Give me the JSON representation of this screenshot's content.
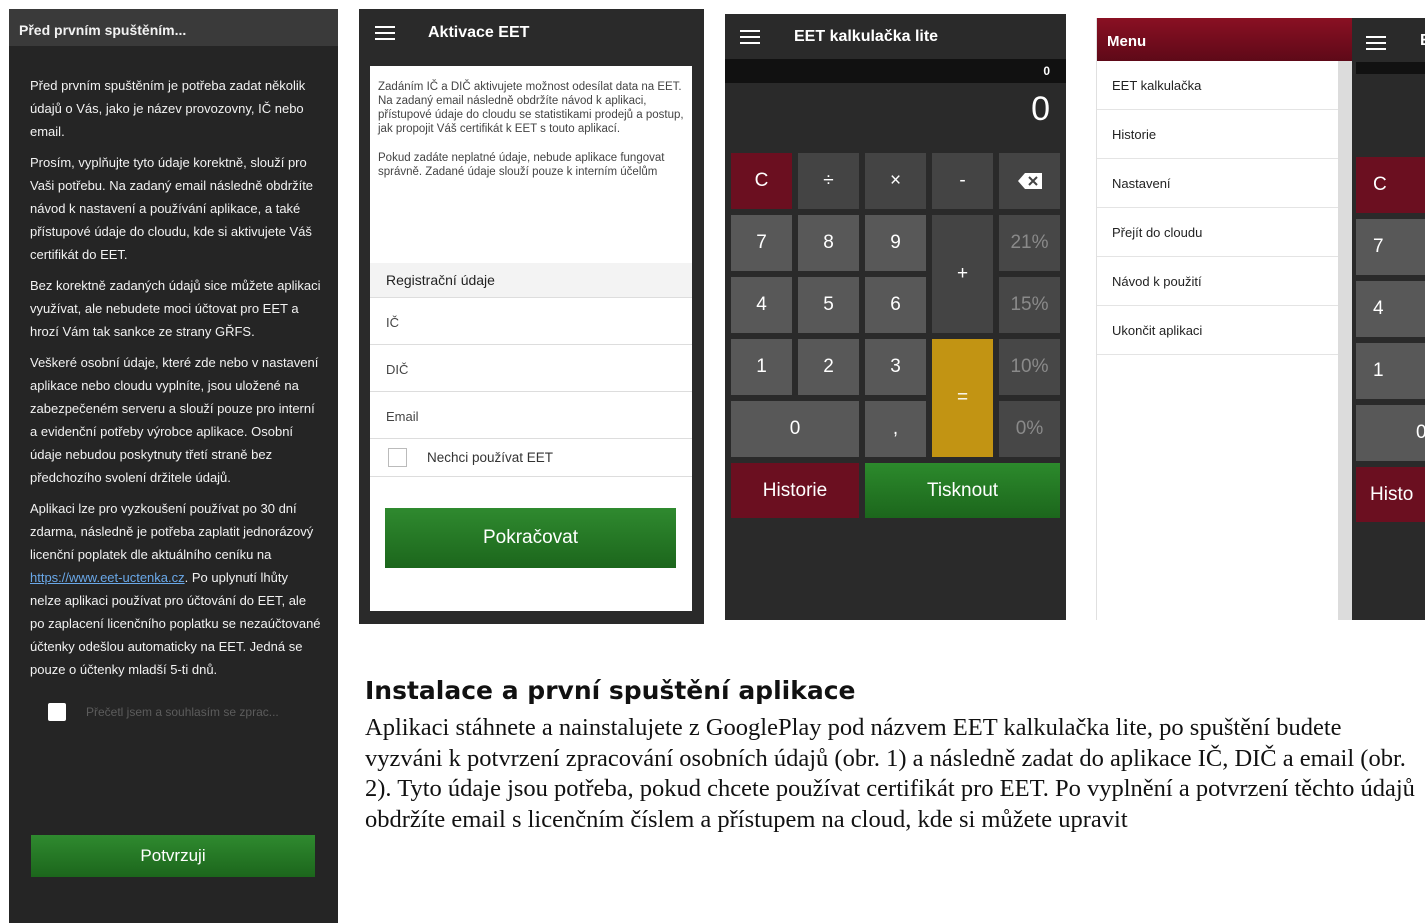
{
  "consent": {
    "title": "Před prvním spuštěním...",
    "para1": "Před prvním spuštěním je potřeba zadat několik údajů o Vás, jako je název provozovny, IČ nebo email.",
    "para2": "Prosím, vyplňujte tyto údaje korektně, slouží pro Vaši potřebu. Na zadaný email následně obdržíte návod k nastavení a používání aplikace, a také přístupové údaje do cloudu, kde si aktivujete Váš certifikát do EET.",
    "para3": "Bez korektně zadaných údajů sice můžete aplikaci využívat, ale nebudete moci účtovat pro EET a hrozí Vám tak sankce ze strany GŘFS.",
    "para4": "Veškeré osobní údaje, které zde nebo v nastavení aplikace nebo cloudu vyplníte, jsou uložené na zabezpečeném serveru a slouží pouze pro interní a evidenční potřeby výrobce aplikace. Osobní údaje nebudou poskytnuty třetí straně bez předchozího svolení držitele údajů.",
    "para5_before": "Aplikaci lze pro vyzkoušení používat po 30 dní zdarma, následně je potřeba zaplatit jednorázový licenční poplatek dle aktuálního ceníku na ",
    "para5_link": "https://www.eet-uctenka.cz",
    "para5_after": ". Po uplynutí lhůty nelze aplikaci používat pro účtování do EET, ale po zaplacení licenčního poplatku se nezaúčtované účtenky odešlou automaticky na EET. Jedná se pouze o účtenky mladší 5-ti dnů.",
    "agree_label": "Přečetl jsem a souhlasím se zprac...",
    "confirm_button": "Potvrzuji"
  },
  "activation": {
    "title": "Aktivace EET",
    "intro1": "Zadáním IČ a DIČ aktivujete možnost odesílat data na EET. Na zadaný email následně obdržíte návod k aplikaci, přístupové údaje do cloudu se statistikami prodejů a postup, jak propojit Váš certifikát k EET s touto aplikací.",
    "intro2": "Pokud zadáte neplatné údaje, nebude aplikace fungovat správně. Zadané údaje slouží pouze k interním účelům",
    "section_title": "Registrační údaje",
    "field_ic": "IČ",
    "field_dic": "DIČ",
    "field_email": "Email",
    "no_eet_label": "Nechci používat EET",
    "continue_button": "Pokračovat"
  },
  "calculator": {
    "title": "EET kalkulačka lite",
    "sub_display": "0",
    "display": "0",
    "keys": {
      "clear": "C",
      "divide": "÷",
      "multiply": "×",
      "minus": "-",
      "seven": "7",
      "eight": "8",
      "nine": "9",
      "pct21": "21%",
      "plus": "+",
      "four": "4",
      "five": "5",
      "six": "6",
      "pct15": "15%",
      "one": "1",
      "two": "2",
      "three": "3",
      "pct10": "10%",
      "equals": "=",
      "zero": "0",
      "comma": ",",
      "pct0": "0%",
      "history": "Historie",
      "print": "Tisknout"
    }
  },
  "drawer": {
    "title": "Menu",
    "items": [
      "EET kalkulačka",
      "Historie",
      "Nastavení",
      "Přejít do cloudu",
      "Návod k použití",
      "Ukončit aplikaci"
    ],
    "behind": {
      "title_cut": "E",
      "clear": "C",
      "seven": "7",
      "four": "4",
      "one": "1",
      "zero": "0",
      "history": "Histo"
    }
  },
  "article": {
    "heading": "Instalace a první spuštění aplikace",
    "text": "Aplikaci stáhnete a nainstalujete z GooglePlay pod názvem EET kalkulačka lite, po spuštění budete vyzváni k potvrzení zpracování osobních údajů (obr. 1) a následně zadat do aplikace IČ, DIČ a email (obr. 2). Tyto údaje jsou potřeba, pokud chcete používat certifikát pro EET. Po vyplnění a potvrzení těchto údajů obdržíte email s licenčním číslem a přístupem na cloud, kde si můžete upravit"
  },
  "colors": {
    "dark_bg": "#2a2a2a",
    "green_button": "#1c661c",
    "red_button": "#6b0f20",
    "equals_gold": "#c29413",
    "menu_header": "#6e0c1c"
  }
}
